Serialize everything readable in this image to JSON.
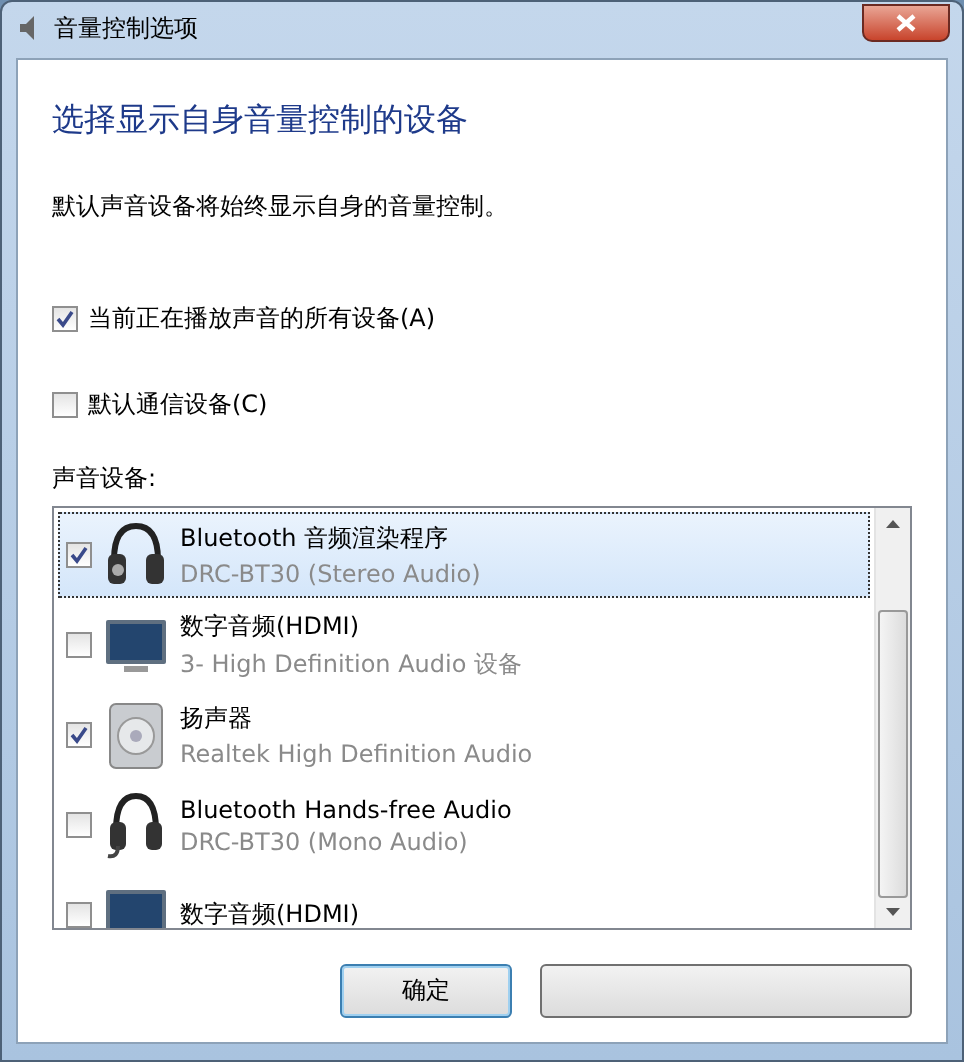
{
  "window": {
    "title": "音量控制选项"
  },
  "heading": "选择显示自身音量控制的设备",
  "description": "默认声音设备将始终显示自身的音量控制。",
  "options": [
    {
      "label": "当前正在播放声音的所有设备(A)",
      "checked": true
    },
    {
      "label": "默认通信设备(C)",
      "checked": false
    }
  ],
  "devices_label": "声音设备:",
  "devices": [
    {
      "kind": "headphones",
      "name": "Bluetooth 音频渲染程序",
      "detail": "DRC-BT30 (Stereo Audio)",
      "checked": true,
      "selected": true
    },
    {
      "kind": "monitor",
      "name": "数字音频(HDMI)",
      "detail": "3- High Definition Audio 设备",
      "checked": false,
      "selected": false
    },
    {
      "kind": "speaker",
      "name": "扬声器",
      "detail": "Realtek High Definition Audio",
      "checked": true,
      "selected": false
    },
    {
      "kind": "headset",
      "name": "Bluetooth Hands-free Audio",
      "detail": "DRC-BT30 (Mono Audio)",
      "checked": false,
      "selected": false
    },
    {
      "kind": "monitor",
      "name": "数字音频(HDMI)",
      "checked": false,
      "selected": false
    }
  ],
  "buttons": [
    {
      "label": "确定",
      "default": true
    },
    {
      "default": false
    }
  ]
}
